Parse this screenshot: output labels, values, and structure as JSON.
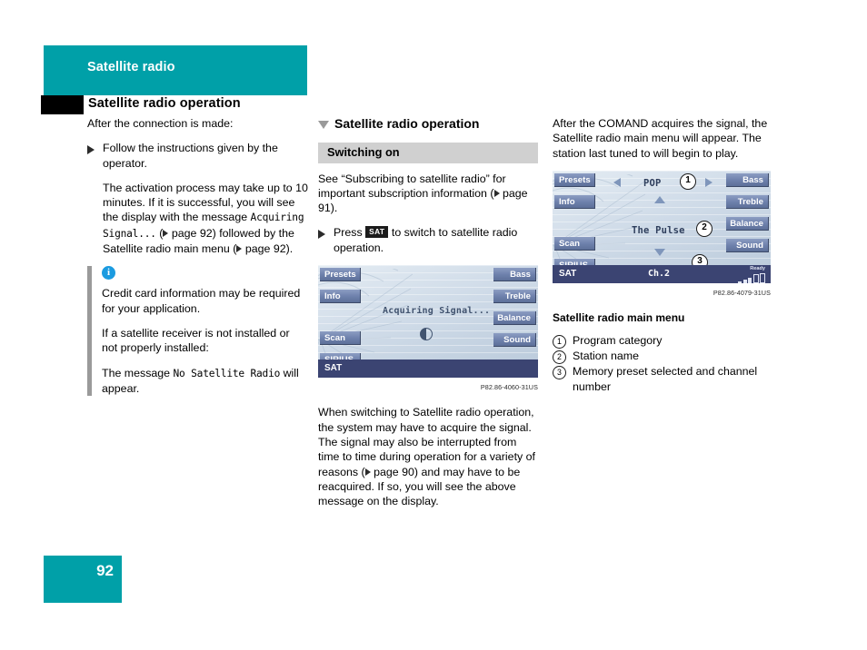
{
  "header": {
    "chapter": "Satellite radio",
    "section": "Satellite radio operation",
    "page_number": "92",
    "teal_color": "#00a0a8"
  },
  "left_column": {
    "intro": "After the connection is made:",
    "step1": "Follow the instructions given by the operator.",
    "para1_a": "The activation process may take up to 10 minutes. If it is successful, you will see the display with the message ",
    "para1_mono": "Acquiring Signal...",
    "para1_b": " (",
    "para1_ref": " page 92) followed by the Satellite radio main menu (",
    "para1_c": " page 92).",
    "note_icon": "info-icon",
    "note1": "Credit card information may be required for your application.",
    "note2": "If a satellite receiver is not installed or not properly installed:",
    "note3_a": "The message ",
    "note3_mono": "No Satellite Radio",
    "note3_b": " will appear."
  },
  "middle_column": {
    "section_title": "Satellite radio operation",
    "subhead": "Switching on",
    "para1_a": "See “Subscribing to satellite radio” for important subscription information (",
    "para1_b": " page 91).",
    "step_a": "Press ",
    "step_key": "SAT",
    "step_b": " to switch to satellite radio operation.",
    "fig_ref": "P82.86-4060-31US",
    "para2_a": "When switching to Satellite radio operation, the system may have to acquire the signal. The signal may also be interrupted from time to time during operation for a variety of reasons (",
    "para2_b": " page 90) and may have to be reacquired. If so, you will see the above message on the display."
  },
  "screen_acquiring": {
    "left_buttons": [
      "Presets",
      "Info",
      "Scan",
      "SIRIUS"
    ],
    "right_buttons": [
      "Bass",
      "Treble",
      "Balance",
      "Sound"
    ],
    "center_text": "Acquiring Signal...",
    "busy_icon": "half-moon-busy-icon",
    "status_left": "SAT"
  },
  "right_column": {
    "intro": "After the COMAND acquires the signal, the Satellite radio main menu will appear. The station last tuned to will begin to play.",
    "fig_ref": "P82.86-4079-31US",
    "caption": "Satellite radio main menu",
    "legend": [
      {
        "num": "1",
        "text": "Program category"
      },
      {
        "num": "2",
        "text": "Station name"
      },
      {
        "num": "3",
        "text": "Memory preset selected and channel number"
      }
    ]
  },
  "screen_mainmenu": {
    "left_buttons": [
      "Presets",
      "Info",
      "Scan",
      "SIRIUS"
    ],
    "right_buttons": [
      "Bass",
      "Treble",
      "Balance",
      "Sound"
    ],
    "category": "POP",
    "station": "The Pulse",
    "status_left": "SAT",
    "status_channel": "Ch.2",
    "status_ready": "Ready",
    "callout_1": "1",
    "callout_2": "2",
    "callout_3": "3"
  }
}
